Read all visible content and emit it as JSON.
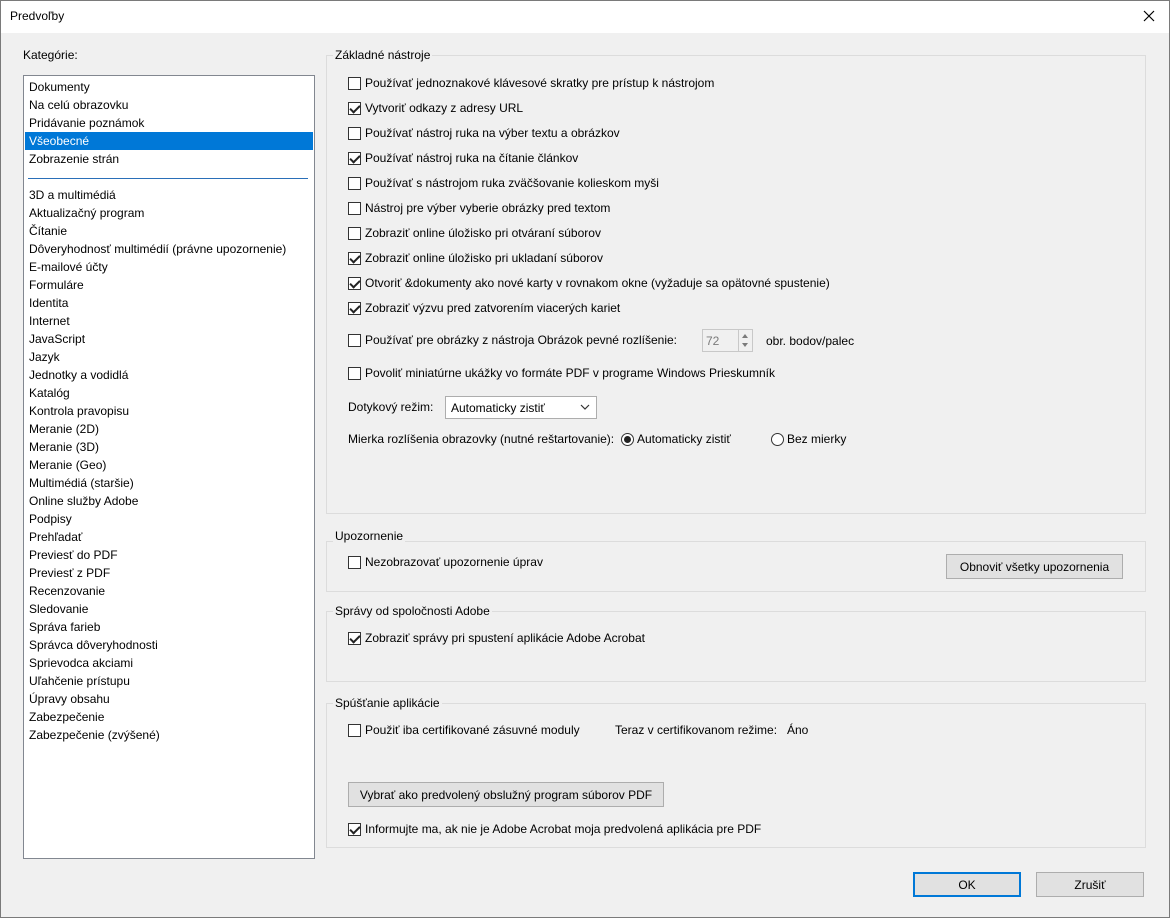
{
  "window": {
    "title": "Predvoľby"
  },
  "categories": {
    "label": "Kategórie:",
    "top_items": [
      "Dokumenty",
      "Na celú obrazovku",
      "Pridávanie poznámok",
      "Všeobecné",
      "Zobrazenie strán"
    ],
    "selected": "Všeobecné",
    "items": [
      "3D a multimédiá",
      "Aktualizačný program",
      "Čítanie",
      "Dôveryhodnosť multimédií (právne upozornenie)",
      "E-mailové účty",
      "Formuláre",
      "Identita",
      "Internet",
      "JavaScript",
      "Jazyk",
      "Jednotky a vodidlá",
      "Katalóg",
      "Kontrola pravopisu",
      "Meranie (2D)",
      "Meranie (3D)",
      "Meranie (Geo)",
      "Multimédiá (staršie)",
      "Online služby Adobe",
      "Podpisy",
      "Prehľadať",
      "Previesť do PDF",
      "Previesť z PDF",
      "Recenzovanie",
      "Sledovanie",
      "Správa farieb",
      "Správca dôveryhodnosti",
      "Sprievodca akciami",
      "Uľahčenie prístupu",
      "Úpravy obsahu",
      "Zabezpečenie",
      "Zabezpečenie (zvýšené)"
    ]
  },
  "basic_tools": {
    "title": "Základné nástroje",
    "options": [
      {
        "label": "Používať jednoznakové klávesové skratky pre prístup k nástrojom",
        "checked": false
      },
      {
        "label": "Vytvoriť odkazy z adresy URL",
        "checked": true
      },
      {
        "label": "Používať nástroj ruka na výber textu a obrázkov",
        "checked": false
      },
      {
        "label": "Používať nástroj ruka na čítanie článkov",
        "checked": true
      },
      {
        "label": "Používať s nástrojom ruka zväčšovanie kolieskom myši",
        "checked": false
      },
      {
        "label": "Nástroj pre výber vyberie obrázky pred textom",
        "checked": false
      },
      {
        "label": "Zobraziť online úložisko pri otváraní súborov",
        "checked": false
      },
      {
        "label": "Zobraziť online úložisko pri ukladaní súborov",
        "checked": true
      },
      {
        "label": "Otvoriť &dokumenty ako nové karty v rovnakom okne (vyžaduje sa opätovné spustenie)",
        "checked": true
      },
      {
        "label": "Zobraziť výzvu pred zatvorením viacerých kariet",
        "checked": true
      }
    ],
    "resolution": {
      "label": "Používať pre obrázky z nástroja Obrázok pevné rozlíšenie:",
      "checked": false,
      "value": "72",
      "unit": "obr. bodov/palec"
    },
    "thumbnails": {
      "label": "Povoliť miniatúrne ukážky vo formáte PDF v programe Windows Prieskumník",
      "checked": false
    },
    "touch_mode": {
      "label": "Dotykový režim:",
      "value": "Automaticky zistiť"
    },
    "scaling": {
      "label": "Mierka rozlíšenia obrazovky (nutné reštartovanie):",
      "option_auto": "Automaticky zistiť",
      "option_none": "Bez mierky",
      "selected": "auto"
    }
  },
  "warnings": {
    "title": "Upozornenie",
    "option": {
      "label": "Nezobrazovať upozornenie úprav",
      "checked": false
    },
    "reset_button": "Obnoviť všetky upozornenia"
  },
  "messages": {
    "title": "Správy od spoločnosti Adobe",
    "option": {
      "label": "Zobraziť správy pri spustení aplikácie Adobe Acrobat",
      "checked": true
    }
  },
  "startup": {
    "title": "Spúšťanie aplikácie",
    "certified": {
      "label": "Použiť iba certifikované zásuvné moduly",
      "checked": false
    },
    "certified_mode_label": "Teraz v certifikovanom režime:",
    "certified_mode_value": "Áno",
    "default_handler_button": "Vybrať ako predvolený obslužný program súborov PDF",
    "notify": {
      "label": "Informujte ma, ak nie je Adobe Acrobat moja predvolená aplikácia pre PDF",
      "checked": true
    }
  },
  "footer": {
    "ok": "OK",
    "cancel": "Zrušiť"
  },
  "colors": {
    "selection": "#0078d7"
  }
}
